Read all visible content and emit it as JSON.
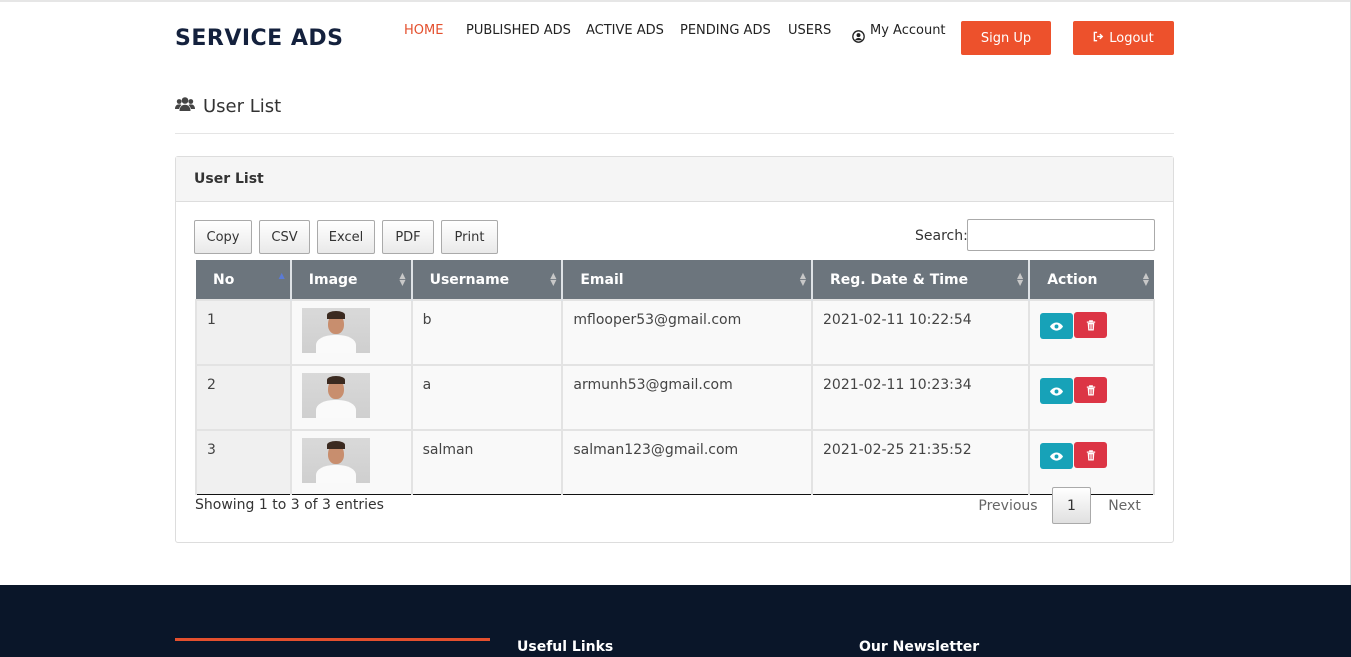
{
  "header": {
    "brand": "SERVICE ADS",
    "nav": [
      {
        "label": "HOME",
        "active": true
      },
      {
        "label": "PUBLISHED ADS",
        "active": false
      },
      {
        "label": "ACTIVE ADS",
        "active": false
      },
      {
        "label": "PENDING ADS",
        "active": false
      },
      {
        "label": "USERS",
        "active": false
      },
      {
        "label": "My Account",
        "active": false
      }
    ],
    "signup_label": "Sign Up",
    "logout_label": "Logout",
    "accent_color": "#ed512c"
  },
  "page": {
    "title": "User List"
  },
  "panel": {
    "title": "User List",
    "export_buttons": [
      "Copy",
      "CSV",
      "Excel",
      "PDF",
      "Print"
    ],
    "search_label": "Search:",
    "search_value": "",
    "columns": [
      "No",
      "Image",
      "Username",
      "Email",
      "Reg. Date & Time",
      "Action"
    ],
    "rows": [
      {
        "no": "1",
        "username": "b",
        "email": "mflooper53@gmail.com",
        "reg": "2021-02-11 10:22:54"
      },
      {
        "no": "2",
        "username": "a",
        "email": "armunh53@gmail.com",
        "reg": "2021-02-11 10:23:34"
      },
      {
        "no": "3",
        "username": "salman",
        "email": "salman123@gmail.com",
        "reg": "2021-02-25 21:35:52"
      }
    ],
    "showing": "Showing 1 to 3 of 3 entries",
    "pager": {
      "previous": "Previous",
      "page": "1",
      "next": "Next"
    }
  },
  "footer": {
    "useful_links": "Useful Links",
    "newsletter": "Our Newsletter",
    "bg_color": "#0a1629"
  }
}
